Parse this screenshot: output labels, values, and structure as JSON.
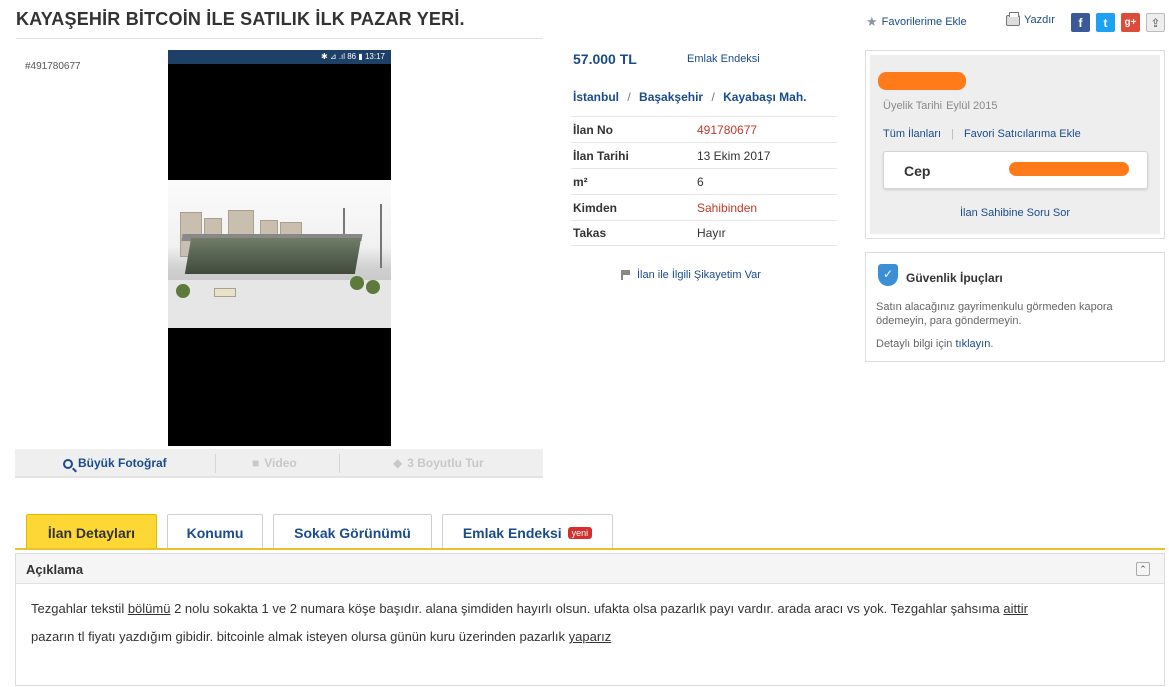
{
  "header": {
    "title": "KAYAŞEHİR BİTCOİN İLE SATILIK İLK PAZAR YERİ.",
    "favorite_label": "Favorilerime Ekle",
    "print_label": "Yazdır",
    "social": {
      "facebook": "f",
      "twitter": "t",
      "googleplus": "g+"
    }
  },
  "photo": {
    "listing_id": "#491780677",
    "status_bar": "✱ ⊿ .ıl 86 ▮ 13:17",
    "tools": {
      "big_photo": "Büyük Fotoğraf",
      "video": "Video",
      "tour": "3 Boyutlu Tur"
    }
  },
  "info": {
    "price": "57.000 TL",
    "endeks_link": "Emlak Endeksi",
    "location": {
      "city": "İstanbul",
      "district": "Başakşehir",
      "neighborhood": "Kayabaşı Mah.",
      "separator": "/"
    },
    "rows": [
      {
        "key": "İlan No",
        "value": "491780677"
      },
      {
        "key": "İlan Tarihi",
        "value": "13 Ekim 2017"
      },
      {
        "key": "m²",
        "value": "6"
      },
      {
        "key": "Kimden",
        "value": "Sahibinden"
      },
      {
        "key": "Takas",
        "value": "Hayır"
      }
    ],
    "complaint": "İlan ile İlgili Şikayetim Var"
  },
  "seller": {
    "member_since_label": "Üyelik Tarihi",
    "member_since": "Eylül 2015",
    "all_listings": "Tüm İlanları",
    "add_favorite_seller": "Favori Satıcılarıma Ekle",
    "separator": "|",
    "phone_label": "Cep",
    "ask_question": "İlan Sahibine Soru Sor"
  },
  "security": {
    "shield_glyph": "✓",
    "title": "Güvenlik İpuçları",
    "text": "Satın alacağınız gayrimenkulu görmeden kapora ödemeyin, para göndermeyin.",
    "more_prefix": "Detaylı bilgi için",
    "more_link": "tıklayın",
    "more_suffix": "."
  },
  "tabs": [
    {
      "label": "İlan Detayları",
      "active": true
    },
    {
      "label": "Konumu"
    },
    {
      "label": "Sokak Görünümü"
    },
    {
      "label": "Emlak Endeksi",
      "badge": "yeni"
    }
  ],
  "description": {
    "title": "Açıklama",
    "collapse_glyph": "⌃",
    "p1": [
      "Tezgahlar tekstil ",
      "bölümü",
      " 2 nolu sokakta 1 ve 2 numara köşe başıdır. alana şimdiden hayırlı olsun. ufakta olsa pazarlık payı vardır. arada aracı vs yok. Tezgahlar şahsıma ",
      "aittir"
    ],
    "p2": [
      "pazarın tl fiyatı yazdığım gibidir. bitcoinle almak isteyen olursa günün kuru üzerinden pazarlık ",
      "yaparız"
    ]
  },
  "colors": {
    "link": "#1a4b8c",
    "accent_tab": "#fdd835",
    "red_value": "#c0392b",
    "redaction": "#ff7b1a"
  }
}
